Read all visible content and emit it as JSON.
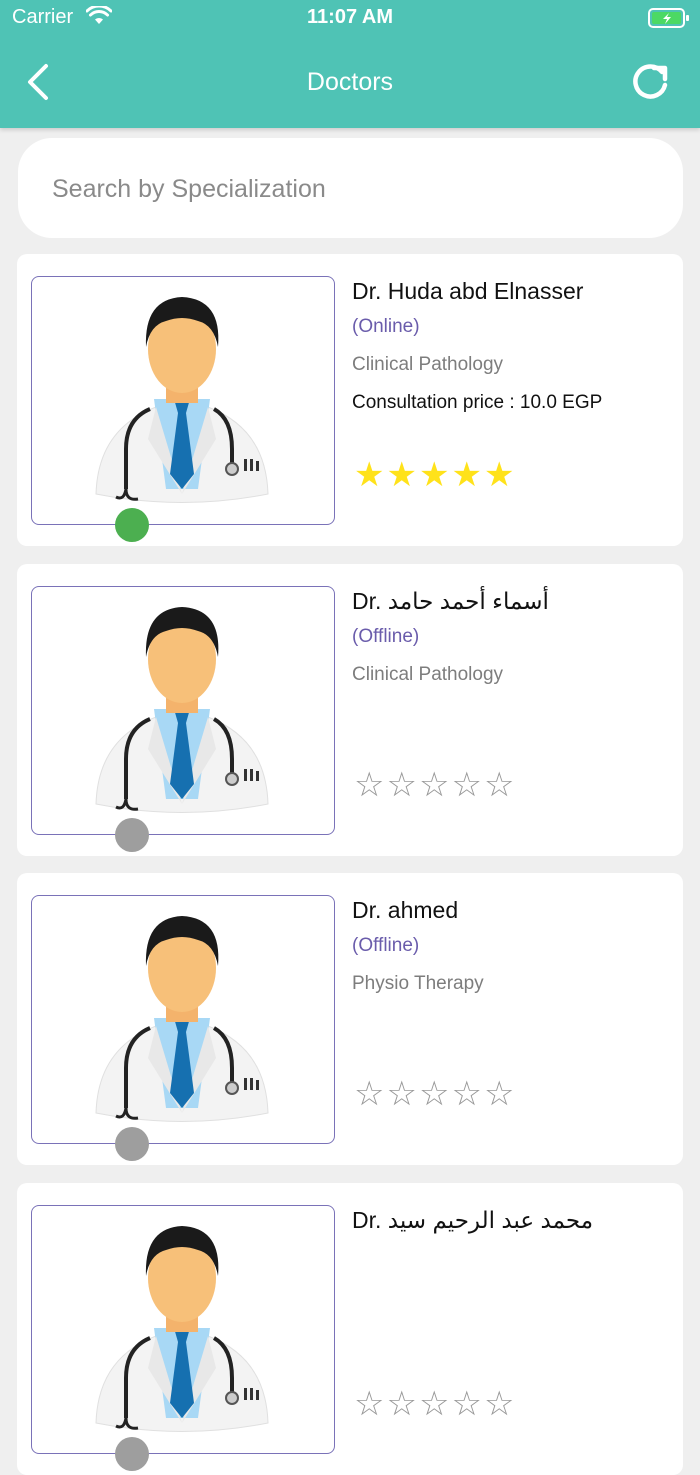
{
  "status_bar": {
    "carrier": "Carrier",
    "time": "11:07 AM"
  },
  "nav": {
    "title": "Doctors"
  },
  "search": {
    "placeholder": "Search by Specialization"
  },
  "colors": {
    "header": "#4fc3b5",
    "online": "#4caf50",
    "offline": "#9e9e9e",
    "star": "#ffe21a",
    "status_text": "#6a5cab"
  },
  "doctors": [
    {
      "name": "Dr. Huda abd Elnasser",
      "status": "(Online)",
      "specialization": "Clinical Pathology",
      "price": "Consultation price  : 10.0 EGP",
      "rating": 5,
      "online": true
    },
    {
      "name": "Dr.  أسماء أحمد حامد",
      "status": "(Offline)",
      "specialization": "Clinical Pathology",
      "price": "",
      "rating": 0,
      "online": false
    },
    {
      "name": "Dr. ahmed",
      "status": "(Offline)",
      "specialization": "Physio Therapy",
      "price": "",
      "rating": 0,
      "online": false
    },
    {
      "name": "Dr.  محمد عبد الرحيم سيد",
      "status": "",
      "specialization": "",
      "price": "",
      "rating": 0,
      "online": false
    }
  ]
}
